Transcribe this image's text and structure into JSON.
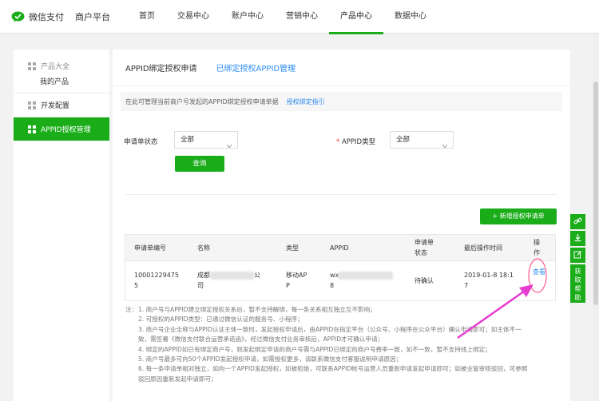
{
  "brand": {
    "name": "微信支付",
    "platform": "商户平台",
    "color": "#1aad19"
  },
  "nav": [
    {
      "label": "首页"
    },
    {
      "label": "交易中心"
    },
    {
      "label": "账户中心"
    },
    {
      "label": "营销中心"
    },
    {
      "label": "产品中心",
      "active": true
    },
    {
      "label": "数据中心"
    }
  ],
  "sidebar": {
    "group_title": "产品大全",
    "group_sub": "我的产品",
    "dev_config": "开发配置",
    "appid_mgmt": "APPID授权管理"
  },
  "tabs": {
    "current": "APPID绑定授权申请",
    "other": "已绑定授权APPID管理"
  },
  "info": {
    "text": "在此可管理当前商户号发起的APPID绑定授权申请单据",
    "guide_link": "授权绑定指引"
  },
  "filters": {
    "status_label": "申请单状态",
    "status_value": "全部",
    "appid_type_required": "*",
    "appid_type_label": "APPID类型",
    "appid_type_value": "全部",
    "query_button": "查询"
  },
  "add_button": "新增授权申请单",
  "table": {
    "headers": [
      "申请单编号",
      "名称",
      "类型",
      "APPID",
      "申请单状态",
      "最后操作时间",
      "操作"
    ],
    "rows": [
      {
        "id": [
          "10001229475",
          "5"
        ],
        "name_prefix": "成都",
        "name_mid": "公",
        "name_end": "司",
        "type": [
          "移动AP",
          "P"
        ],
        "appid_prefix": "wx",
        "appid_end": "8",
        "status": "待确认",
        "time": [
          "2019-01-8 18:1",
          "7"
        ],
        "action": "查看"
      }
    ]
  },
  "notes": [
    {
      "head": "注：",
      "text": "1. 商户号与APPID建立绑定授权关系后，暂不支持解绑，每一条关系相互独立互不影响；"
    },
    {
      "head": "",
      "text": "2. 可授权的APPID类型：已通过微信认证的服务号、小程序；"
    },
    {
      "head": "",
      "text": "3. 商户号企业全称与APPID认证主体一致时，发起授权申请后，由APPID在指定平台（公众号、小程序在公众平台）确认申请即可；如主体不一"
    },
    {
      "head": "",
      "text": "致，需签署《微信支付联合运营承诺函》，经过微信支付业务审核后，APPID才可确认申请；"
    },
    {
      "head": "",
      "text": "4. 绑定的APPID如已有绑定商户号，则发起绑定申请的商户号需与APPID已绑定的商户号费率一致，如不一致，暂不支持线上绑定；"
    },
    {
      "head": "",
      "text": "5. 商户号最多可向50个APPID发起授权申请，如需授权更多，请联系微信支付客服说明申请原因；"
    },
    {
      "head": "",
      "text": "6. 每一条申请单相对独立，如向一个APPID发起授权，如被拒绝，可联系APPID帐号运营人员重新申请发起申请即可；如被业管审核驳回，可参照"
    },
    {
      "head": "",
      "text": "驳回原因重新发起申请即可；"
    }
  ],
  "float_help": [
    "获",
    "取",
    "帮",
    "助"
  ]
}
